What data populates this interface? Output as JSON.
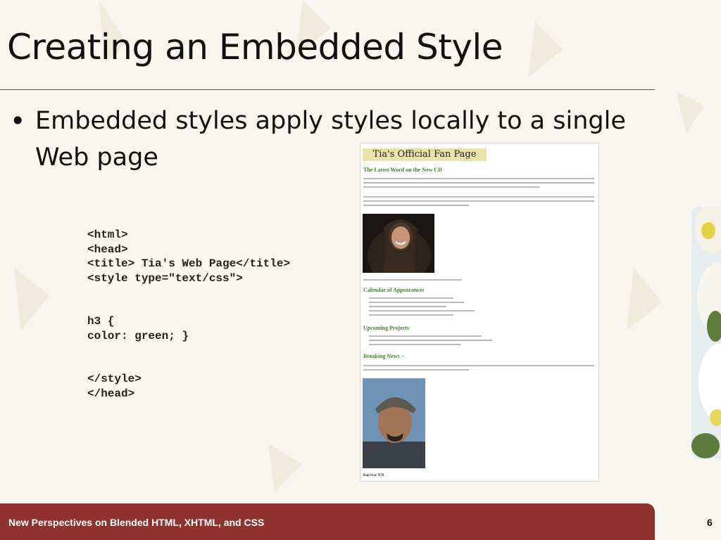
{
  "slide": {
    "title": "Creating an Embedded Style",
    "bullet": "Embedded styles apply styles locally to a single Web page",
    "code": "<html>\n<head>\n<title> Tia's Web Page</title>\n<style type=\"text/css\">\n\n\nh3 {\ncolor: green; }\n\n\n</style>\n</head>",
    "footer": "New Perspectives on Blended HTML, XHTML, and CSS",
    "number": "6"
  },
  "screenshot": {
    "banner": "Tia's Official Fan Page",
    "sections": [
      "The Latest Word on the New CD",
      "Calendar of Appearances",
      "Upcoming Projects",
      "Breaking News –"
    ],
    "caption": "Rap Star N70"
  },
  "colors": {
    "footer": "#8f3330",
    "heading_green": "#3c8b2c",
    "banner": "#e9e2a9"
  }
}
